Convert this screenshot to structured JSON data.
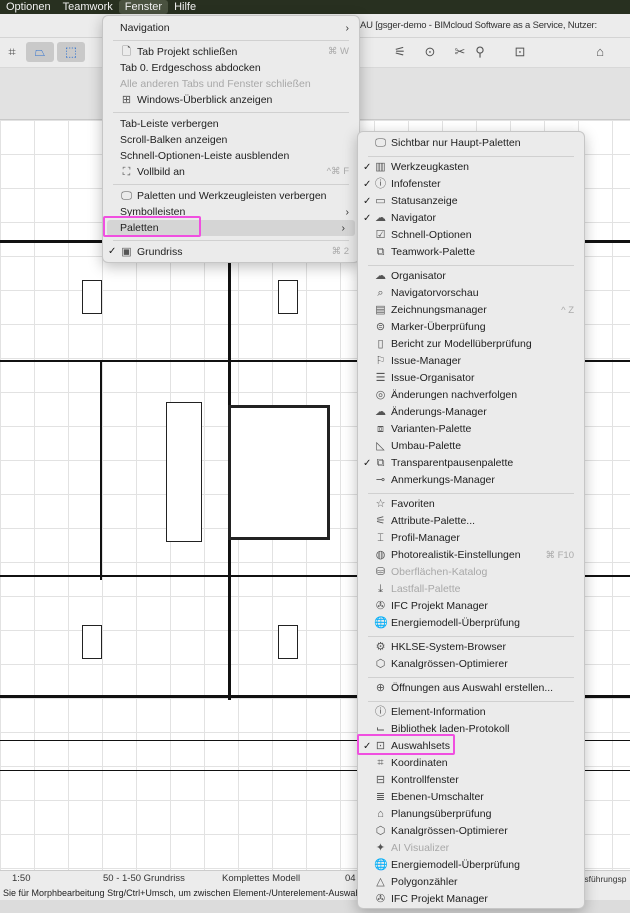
{
  "menubar": [
    "Optionen",
    "Teamwork",
    "Fenster",
    "Hilfe"
  ],
  "active_menu": "Fenster",
  "window_title": "AU [gsger-demo - BIMcloud Software as a Service, Nutzer:",
  "main_menu": [
    {
      "label": "Navigation",
      "submenu": true
    },
    {
      "sep": true
    },
    {
      "label": "Tab Projekt schließen",
      "icon": "document-close-icon",
      "shortcut": "⌘ W"
    },
    {
      "label": "Tab 0. Erdgeschoss abdocken"
    },
    {
      "label": "Alle anderen Tabs und Fenster schließen",
      "disabled": true
    },
    {
      "label": "Windows-Überblick anzeigen",
      "icon": "grid-icon"
    },
    {
      "sep": true
    },
    {
      "label": "Tab-Leiste verbergen"
    },
    {
      "label": "Scroll-Balken anzeigen"
    },
    {
      "label": "Schnell-Optionen-Leiste ausblenden"
    },
    {
      "label": "Vollbild an",
      "icon": "fullscreen-icon",
      "shortcut": "^⌘ F"
    },
    {
      "sep": true
    },
    {
      "label": "Paletten und Werkzeugleisten verbergen",
      "icon": "monitor-icon"
    },
    {
      "label": "Symbolleisten",
      "submenu": true
    },
    {
      "label": "Paletten",
      "submenu": true,
      "highlighted": true
    },
    {
      "sep": true
    },
    {
      "label": "Grundriss",
      "icon": "floorplan-icon",
      "checked": true,
      "shortcut": "⌘ 2"
    }
  ],
  "palettes_menu": [
    {
      "label": "Sichtbar nur Haupt-Paletten",
      "icon": "monitor-icon"
    },
    {
      "sep": true
    },
    {
      "label": "Werkzeugkasten",
      "icon": "toolbox-icon",
      "checked": true
    },
    {
      "label": "Infofenster",
      "icon": "info-icon",
      "checked": true
    },
    {
      "label": "Statusanzeige",
      "icon": "status-icon",
      "checked": true
    },
    {
      "label": "Navigator",
      "icon": "navigator-icon",
      "checked": true
    },
    {
      "label": "Schnell-Optionen",
      "icon": "quick-options-icon"
    },
    {
      "label": "Teamwork-Palette",
      "icon": "teamwork-icon"
    },
    {
      "sep": true
    },
    {
      "label": "Organisator",
      "icon": "organizer-icon"
    },
    {
      "label": "Navigatorvorschau",
      "icon": "preview-icon"
    },
    {
      "label": "Zeichnungsmanager",
      "icon": "drawing-manager-icon",
      "shortcut": "^ Z"
    },
    {
      "label": "Marker-Überprüfung",
      "icon": "marker-check-icon"
    },
    {
      "label": "Bericht zur Modellüberprüfung",
      "icon": "report-icon"
    },
    {
      "label": "Issue-Manager",
      "icon": "flag-icon"
    },
    {
      "label": "Issue-Organisator",
      "icon": "issue-organizer-icon"
    },
    {
      "label": "Änderungen nachverfolgen",
      "icon": "track-changes-icon"
    },
    {
      "label": "Änderungs-Manager",
      "icon": "change-manager-icon"
    },
    {
      "label": "Varianten-Palette",
      "icon": "variants-icon"
    },
    {
      "label": "Umbau-Palette",
      "icon": "renovation-icon"
    },
    {
      "label": "Transparentpausenpalette",
      "icon": "trace-icon",
      "checked": true
    },
    {
      "label": "Anmerkungs-Manager",
      "icon": "annotation-icon"
    },
    {
      "sep": true
    },
    {
      "label": "Favoriten",
      "icon": "star-icon"
    },
    {
      "label": "Attribute-Palette...",
      "icon": "attributes-icon"
    },
    {
      "label": "Profil-Manager",
      "icon": "profile-icon"
    },
    {
      "label": "Photorealistik-Einstellungen",
      "icon": "render-icon",
      "shortcut": "⌘ F10"
    },
    {
      "label": "Oberflächen-Katalog",
      "icon": "surface-icon",
      "disabled": true
    },
    {
      "label": "Lastfall-Palette",
      "icon": "load-icon",
      "disabled": true
    },
    {
      "label": "IFC Projekt Manager",
      "icon": "ifc-icon"
    },
    {
      "label": "Energiemodell-Überprüfung",
      "icon": "globe-icon"
    },
    {
      "sep": true
    },
    {
      "label": "HKLSE-System-Browser",
      "icon": "mep-icon"
    },
    {
      "label": "Kanalgrössen-Optimierer",
      "icon": "duct-icon"
    },
    {
      "sep": true
    },
    {
      "label": "Öffnungen aus Auswahl erstellen...",
      "icon": "openings-icon"
    },
    {
      "sep": true
    },
    {
      "label": "Element-Information",
      "icon": "element-info-icon"
    },
    {
      "label": "Bibliothek laden-Protokoll",
      "icon": "library-icon"
    },
    {
      "label": "Auswahlsets",
      "icon": "selection-sets-icon",
      "checked": true
    },
    {
      "label": "Koordinaten",
      "icon": "coordinates-icon"
    },
    {
      "label": "Kontrollfenster",
      "icon": "control-box-icon"
    },
    {
      "label": "Ebenen-Umschalter",
      "icon": "layers-icon"
    },
    {
      "label": "Planungsüberprüfung",
      "icon": "design-check-icon"
    },
    {
      "label": "Kanalgrössen-Optimierer",
      "icon": "duct-icon"
    },
    {
      "label": "AI Visualizer",
      "icon": "ai-icon",
      "disabled": true
    },
    {
      "label": "Energiemodell-Überprüfung",
      "icon": "globe-icon"
    },
    {
      "label": "Polygonzähler",
      "icon": "polygon-icon"
    },
    {
      "label": "IFC Projekt Manager",
      "icon": "ifc-icon"
    }
  ],
  "status": {
    "scale": "1:50",
    "view": "50 - 1-50 Grundriss",
    "model": "Komplettes Modell",
    "pen": "04",
    "right": "Ausführungsp"
  },
  "hint": "Sie für Morphbearbeitung Strg/Ctrl+Umsch, um zwischen Element-/Unterelement-Auswahl zu w",
  "colors": {
    "highlight_box": "#f04fe0",
    "menubar": "#283020"
  }
}
